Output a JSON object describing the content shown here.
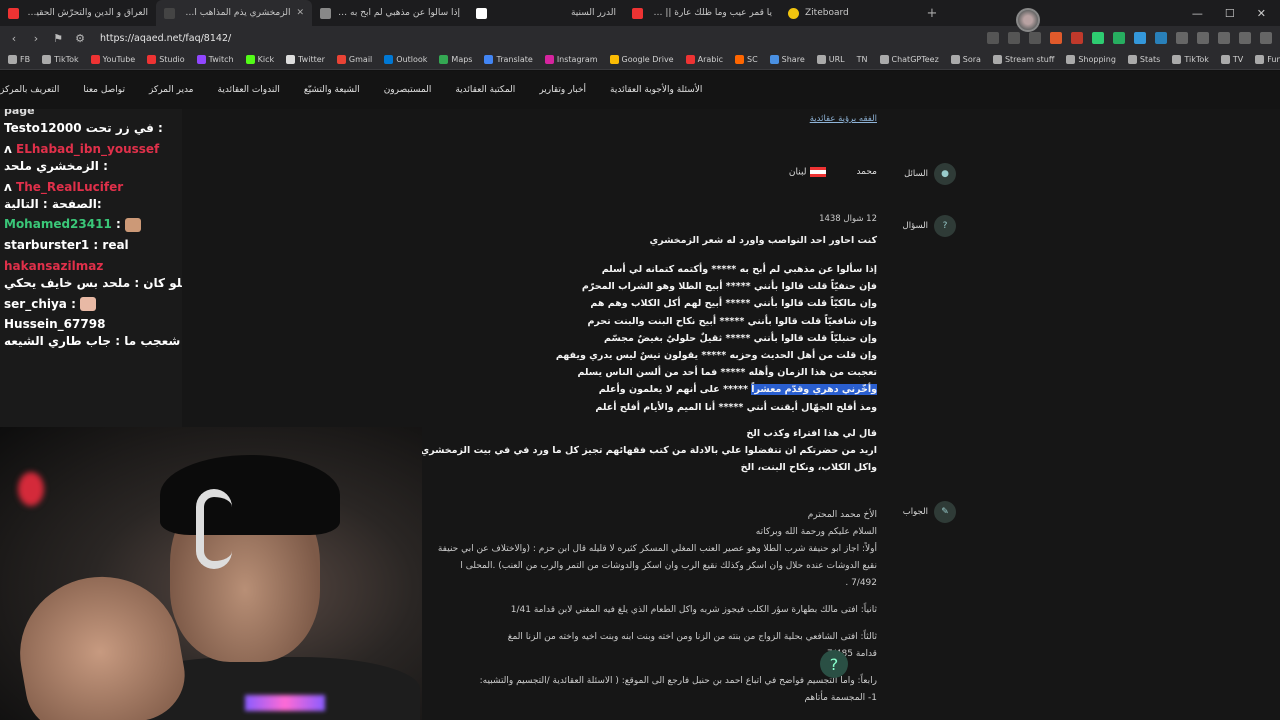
{
  "browser": {
    "tabs": [
      {
        "title": "العراق و الدين والتحرّش الحقيقة الكاملة",
        "color": "#e33",
        "active": false
      },
      {
        "title": "الزمخشري يذم المذاهب الاربعة",
        "color": "#444",
        "active": true
      },
      {
        "title": "إذا سألوا عن مذهبي لم أبح به - الزمخشري",
        "color": "#888",
        "active": false
      },
      {
        "title": "الدرر السنية",
        "color": "#fff",
        "active": false
      },
      {
        "title": "يا قمر عيب وما ظلك عارة || شفت الغزا",
        "color": "#e33",
        "active": false
      },
      {
        "title": "Ziteboard",
        "color": "#f1c40f",
        "active": false
      }
    ],
    "url": "https://aqaed.net/faq/8142/",
    "bookmarks": [
      "FB",
      "TikTok",
      "YouTube",
      "Studio",
      "Twitch",
      "Kick",
      "Twitter",
      "Gmail",
      "Outlook",
      "Maps",
      "Translate",
      "Instagram",
      "Google Drive",
      "Arabic",
      "SC",
      "Share",
      "URL",
      "TN",
      "ChatGPTeez",
      "Sora",
      "Stream stuff",
      "Shopping",
      "Stats",
      "TikTok",
      "TV",
      "Fun"
    ]
  },
  "site_nav": {
    "items": [
      "الأسئلة والأجوبة العقائدية",
      "أخبار وتقارير",
      "المكتبة العقائدية",
      "المستبصرون",
      "الشيعة والتشيّع",
      "الندوات العقائدية",
      "مدير المركز",
      "تواصل معنا",
      "التعريف بالمركز"
    ]
  },
  "question": {
    "breadcrumb": "الفقه برؤية عقائدية",
    "asker_label": "السائل",
    "asker_name": "محمد",
    "country": "لبنان",
    "question_label": "السؤال",
    "date": "12 شوال 1438",
    "intro": "كنت احاور احد النواصب واورد له شعر الزمخشري",
    "poem": [
      "إذا سألوا عن مذهبي لم أبح به ***** وأكتمه كتمانه لي أسلم",
      "فإن حنفيّاً قلت قالوا بأنني ***** أبيح الطلا وهو الشراب المحرّم",
      "وإن مالكيّاً قلت قالوا بأنني ***** أبيح لهم أكل الكلاب وهم هم",
      "وإن شافعيّاً قلت قالوا بأنني ***** أبيح نكاح البنت والبنت تحرم",
      "وإن حنبليّاً قلت قالوا بأنني ***** ثقيلٌ حلوليٌ بغيضٌ مجسّم",
      "وإن قلت من أهل الحديث وحزبه ***** يقولون تيسٌ ليس يدري ويفهم",
      "تعجبت من هذا الزمان وأهله ***** فما أحد من ألسن الناس يسلم",
      "وأخّرني دهري وقدّم معشراً ***** على أنهم لا يعلمون وأعلم",
      "ومذ أفلح الجهّال أيقنت أنني ***** أنا الميم والأيام أفلح أعلم"
    ],
    "poem_highlight": "وأخّرني دهري وقدّم معشراً",
    "tail": [
      "قال لي هذا افتراء وكذب الخ",
      "اريد من حضرتكم ان تتفضلوا علي بالادلة من كتب فقهائهم تجيز كل ما ورد في في بيت الزمخشري من اباحة",
      "واكل الكلاب، ونكاح البنت، الخ"
    ]
  },
  "answer": {
    "label": "الجواب",
    "lines": [
      "الأخ محمد المحترم",
      "السلام عليكم ورحمة الله وبركاته",
      "أولاً: اجاز ابو حنيفة شرب الطلا وهو عصير العنب المغلي المسكر كثيره لا قليله قال ابن حزم : (والاختلاف عن ابي حنيفة",
      "نقيع الدوشات عنده حلال وان اسكر وكذلك نقيع الرب وان اسكر والدوشات من التمر والرب من العنب) .المحلى ا",
      "7/492 .",
      "",
      "ثانياً: افتى مالك بطهارة سؤر الكلب فيجوز شربه واكل الطعام الذي يلغ فيه المغني لابن قدامة 1/41",
      "",
      "ثالثاً: افتى الشافعي بحلية الزواج من بنته من الزنا ومن اخته وبنت ابنه وبنت اخيه واخته من الزنا المغ",
      "قدامة 7/485",
      "",
      "رابعاً: واما التجسيم فواضح في اتباع احمد بن حنبل فارجع الى الموقع: ( الاسئلة العقائدية /التجسيم والتشبيه:",
      "1- المجسمة مأتاهم"
    ]
  },
  "chat": {
    "top_partial": "page",
    "messages": [
      {
        "user": "Testo12000",
        "user_color": "#ffffff",
        "text": "في زر تحت :",
        "badge": ""
      },
      {
        "user": "ELhabad_ibn_youssef",
        "user_color": "#e0304a",
        "text": "الزمخشري ملحد :",
        "badge": "ʌ"
      },
      {
        "user": "The_RealLucifer",
        "user_color": "#e0304a",
        "text": "الصفحة : التالية:",
        "badge": "ʌ"
      },
      {
        "user": "Mohamed23411",
        "user_color": "#3ac778",
        "text": ":",
        "badge": ""
      },
      {
        "user": "starburster1",
        "user_color": "#ffffff",
        "text": ": real",
        "badge": ""
      },
      {
        "user": "hakansazilmaz",
        "user_color": "#e0304a",
        "text": "شكلو كان : ملحد بس خايف يحكي",
        "badge": ""
      },
      {
        "user": "ser_chiya",
        "user_color": "#ffffff",
        "text": ":",
        "badge": ""
      },
      {
        "user": "Hussein_67798",
        "user_color": "#ffffff",
        "text": "شعجب ما : جاب طاري الشيعه 😂",
        "badge": ""
      }
    ]
  }
}
